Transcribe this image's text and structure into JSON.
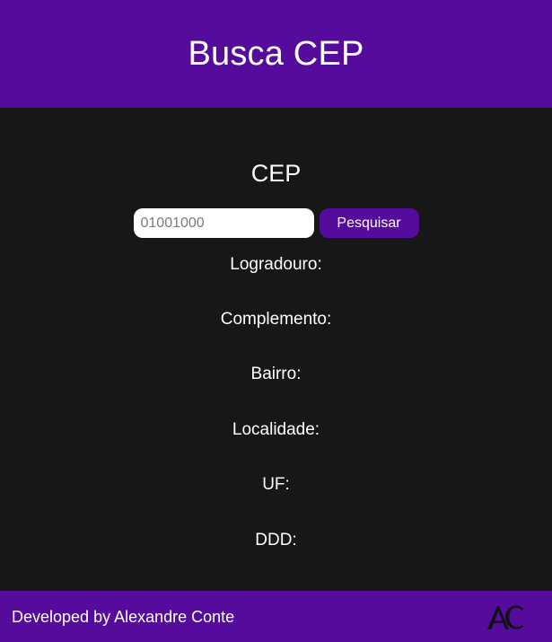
{
  "header": {
    "title": "Busca CEP"
  },
  "search": {
    "label": "CEP",
    "placeholder": "01001000",
    "button_label": "Pesquisar"
  },
  "fields": {
    "logradouro": "Logradouro:",
    "complemento": "Complemento:",
    "bairro": "Bairro:",
    "localidade": "Localidade:",
    "uf": "UF:",
    "ddd": "DDD:"
  },
  "footer": {
    "credit": "Developed by Alexandre Conte",
    "logo": "AC"
  },
  "colors": {
    "brand": "#550c9c",
    "background": "#171717",
    "text": "#ffffff"
  }
}
